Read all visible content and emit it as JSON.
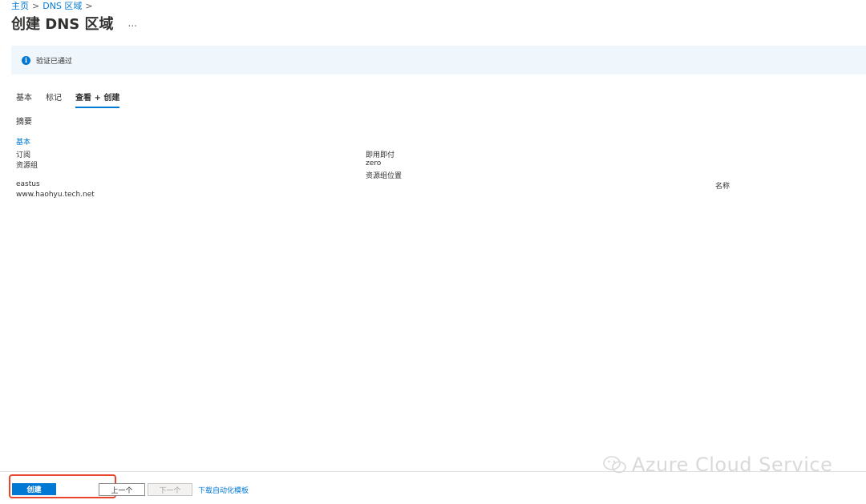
{
  "breadcrumb": {
    "home": "主页",
    "sep1": ">",
    "dns_zones": "DNS 区域",
    "sep2": ">"
  },
  "header": {
    "title": "创建 DNS 区域",
    "more": "..."
  },
  "info_bar": {
    "text": "验证已通过"
  },
  "tabs": [
    {
      "label": "基本",
      "active": false
    },
    {
      "label": "标记",
      "active": false
    },
    {
      "label": "查看 + 创建",
      "active": true
    }
  ],
  "summary": {
    "heading": "摘要",
    "section": "基本",
    "col1": [
      "订阅",
      "资源组",
      "eastus",
      "www.haohyu.tech.net"
    ],
    "col2": [
      "即用即付",
      "zero",
      "资源组位置"
    ],
    "col3": [
      "名称"
    ]
  },
  "footer": {
    "create": "创建",
    "previous": "上一个",
    "next": "下一个",
    "download": "下载自动化模板"
  },
  "watermark": {
    "text": "Azure Cloud Service",
    "icon": "wechat-icon"
  },
  "colors": {
    "accent": "#0078d4",
    "info_bg": "#eff6fc",
    "highlight": "#e8452c"
  }
}
